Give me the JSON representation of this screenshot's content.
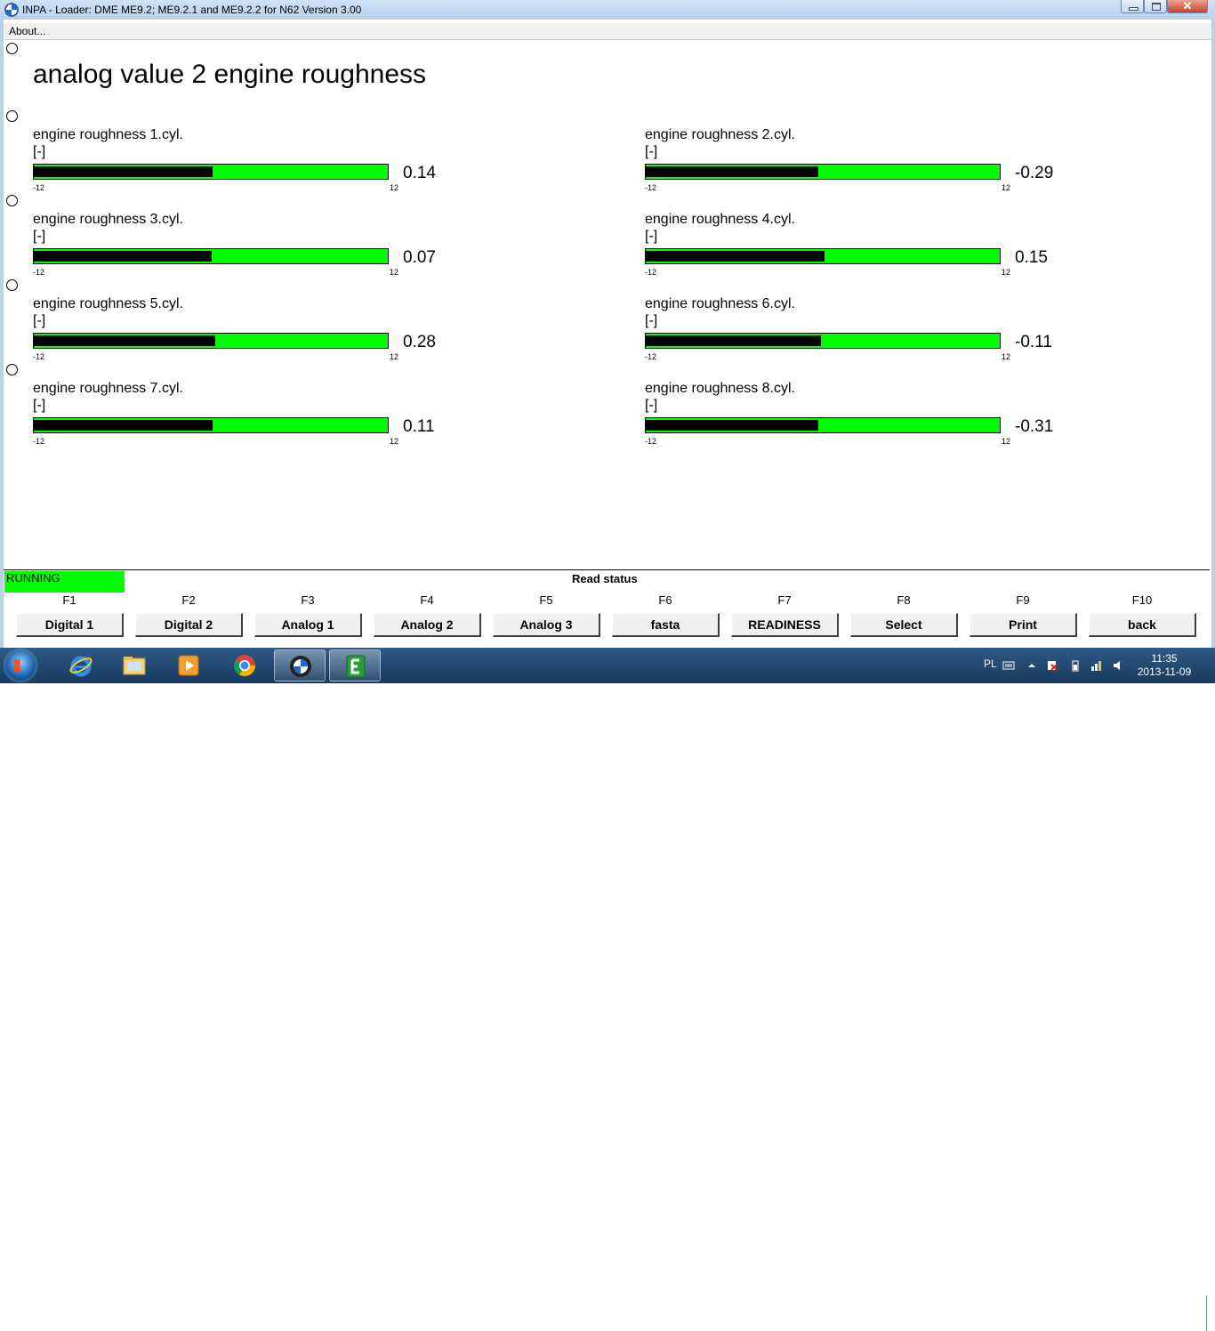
{
  "window": {
    "title": "INPA - Loader:  DME ME9.2; ME9.2.1 and ME9.2.2 for N62 Version 3.00"
  },
  "menu": {
    "about": "About..."
  },
  "main": {
    "heading": "analog value 2 engine roughness",
    "meters": [
      {
        "label": "engine roughness 1.cyl.",
        "unit": "[-]",
        "min": "-12",
        "max": "12",
        "value": "0.14",
        "fill_fraction": 0.506
      },
      {
        "label": "engine roughness 2.cyl.",
        "unit": "[-]",
        "min": "-12",
        "max": "12",
        "value": "-0.29",
        "fill_fraction": 0.488
      },
      {
        "label": "engine roughness 3.cyl.",
        "unit": "[-]",
        "min": "-12",
        "max": "12",
        "value": "0.07",
        "fill_fraction": 0.503
      },
      {
        "label": "engine roughness 4.cyl.",
        "unit": "[-]",
        "min": "-12",
        "max": "12",
        "value": "0.15",
        "fill_fraction": 0.506
      },
      {
        "label": "engine roughness 5.cyl.",
        "unit": "[-]",
        "min": "-12",
        "max": "12",
        "value": "0.28",
        "fill_fraction": 0.512
      },
      {
        "label": "engine roughness 6.cyl.",
        "unit": "[-]",
        "min": "-12",
        "max": "12",
        "value": "-0.11",
        "fill_fraction": 0.495
      },
      {
        "label": "engine roughness 7.cyl.",
        "unit": "[-]",
        "min": "-12",
        "max": "12",
        "value": "0.11",
        "fill_fraction": 0.505
      },
      {
        "label": "engine roughness 8.cyl.",
        "unit": "[-]",
        "min": "-12",
        "max": "12",
        "value": "-0.31",
        "fill_fraction": 0.487
      }
    ]
  },
  "status": {
    "running": "RUNNING",
    "read_status": "Read status"
  },
  "fkeys": [
    {
      "key": "F1",
      "label": "Digital 1"
    },
    {
      "key": "F2",
      "label": "Digital 2"
    },
    {
      "key": "F3",
      "label": "Analog 1"
    },
    {
      "key": "F4",
      "label": "Analog 2"
    },
    {
      "key": "F5",
      "label": "Analog 3"
    },
    {
      "key": "F6",
      "label": "fasta"
    },
    {
      "key": "F7",
      "label": "READINESS"
    },
    {
      "key": "F8",
      "label": "Select"
    },
    {
      "key": "F9",
      "label": "Print"
    },
    {
      "key": "F10",
      "label": "back"
    }
  ],
  "taskbar": {
    "items": [
      "start-orb",
      "internet-explorer-icon",
      "file-explorer-icon",
      "media-player-icon",
      "chrome-icon",
      "bmw-icon",
      "ediabas-icon"
    ],
    "language": "PL",
    "time": "11:35",
    "date": "2013-11-09"
  },
  "colors": {
    "bar_background": "#00ff00",
    "bar_fill": "#000000",
    "running": "#00ff00"
  }
}
